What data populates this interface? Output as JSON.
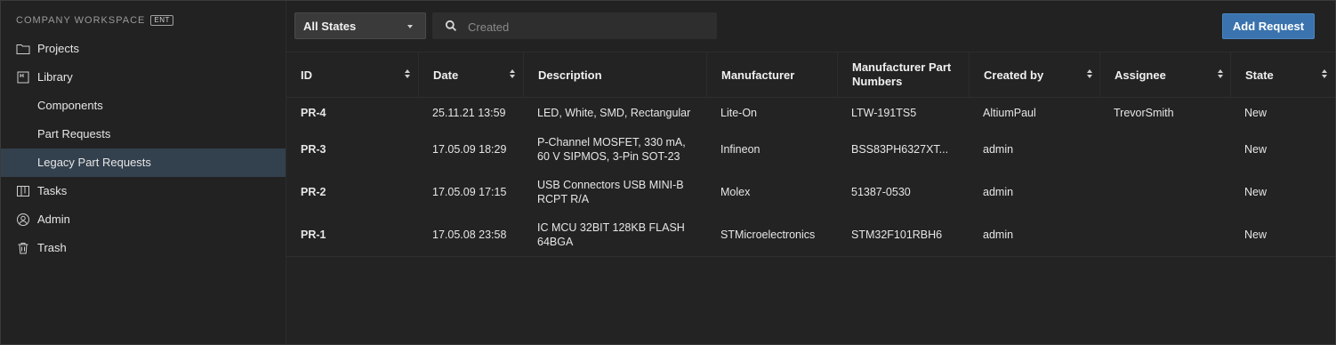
{
  "sidebar": {
    "workspace_title": "COMPANY WORKSPACE",
    "badge": "ENT",
    "items": [
      {
        "label": "Projects",
        "icon": "folder-icon"
      },
      {
        "label": "Library",
        "icon": "library-icon"
      },
      {
        "label": "Components",
        "icon": ""
      },
      {
        "label": "Part Requests",
        "icon": ""
      },
      {
        "label": "Legacy Part Requests",
        "icon": "",
        "active": true
      },
      {
        "label": "Tasks",
        "icon": "tasks-icon"
      },
      {
        "label": "Admin",
        "icon": "user-icon"
      },
      {
        "label": "Trash",
        "icon": "trash-icon"
      }
    ]
  },
  "toolbar": {
    "state_filter": "All States",
    "search_placeholder": "Created",
    "add_button": "Add Request"
  },
  "table": {
    "columns": [
      {
        "label": "ID",
        "sortable": true
      },
      {
        "label": "Date",
        "sortable": true
      },
      {
        "label": "Description",
        "sortable": false
      },
      {
        "label": "Manufacturer",
        "sortable": false
      },
      {
        "label": "Manufacturer Part Numbers",
        "sortable": false
      },
      {
        "label": "Created by",
        "sortable": true
      },
      {
        "label": "Assignee",
        "sortable": true
      },
      {
        "label": "State",
        "sortable": true
      }
    ],
    "rows": [
      {
        "id": "PR-4",
        "date": "25.11.21 13:59",
        "description": "LED, White, SMD, Rectangular",
        "manufacturer": "Lite-On",
        "mpn": "LTW-191TS5",
        "created_by": "AltiumPaul",
        "assignee": "TrevorSmith",
        "state": "New"
      },
      {
        "id": "PR-3",
        "date": "17.05.09 18:29",
        "description": "P-Channel MOSFET, 330 mA, 60 V SIPMOS, 3-Pin SOT-23",
        "manufacturer": "Infineon",
        "mpn": "BSS83PH6327XT...",
        "created_by": "admin",
        "assignee": "",
        "state": "New"
      },
      {
        "id": "PR-2",
        "date": "17.05.09 17:15",
        "description": "USB Connectors USB MINI-B RCPT R/A",
        "manufacturer": "Molex",
        "mpn": "51387-0530",
        "created_by": "admin",
        "assignee": "",
        "state": "New"
      },
      {
        "id": "PR-1",
        "date": "17.05.08 23:58",
        "description": "IC MCU 32BIT 128KB FLASH 64BGA",
        "manufacturer": "STMicroelectronics",
        "mpn": "STM32F101RBH6",
        "created_by": "admin",
        "assignee": "",
        "state": "New"
      }
    ]
  },
  "colors": {
    "accent": "#3a73ad",
    "active_nav": "#33404d",
    "background": "#232323"
  }
}
